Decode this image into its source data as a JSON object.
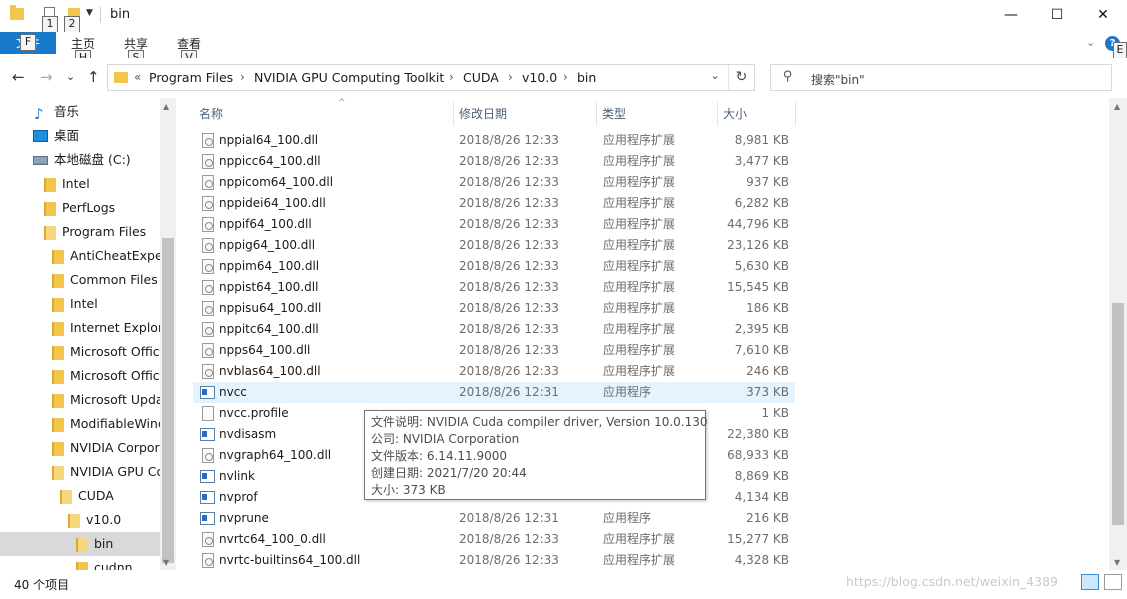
{
  "window": {
    "title": "bin",
    "minimize_glyph": "—",
    "maximize_glyph": "☐",
    "close_glyph": "✕"
  },
  "keytips": {
    "qat1": "1",
    "qat2": "2",
    "file": "F",
    "home": "H",
    "share": "S",
    "view": "V",
    "help": "E"
  },
  "ribbon": {
    "file_label": "文件",
    "tabs": [
      "主页",
      "共享",
      "查看"
    ],
    "help_glyph": "?"
  },
  "nav": {
    "back_glyph": "←",
    "forward_glyph": "→",
    "recent_glyph": "⌄",
    "up_glyph": "↑"
  },
  "address": {
    "overflow": "«",
    "crumbs": [
      "Program Files",
      "NVIDIA GPU Computing Toolkit",
      "CUDA",
      "v10.0",
      "bin"
    ],
    "dropdown_glyph": "⌄",
    "refresh_glyph": "↻"
  },
  "search": {
    "placeholder": "搜索\"bin\"",
    "icon": "search-icon"
  },
  "tree": [
    {
      "label": "音乐",
      "icon": "music-icon"
    },
    {
      "label": "桌面",
      "icon": "desktop-icon"
    },
    {
      "label": "本地磁盘 (C:)",
      "icon": "drive-icon"
    },
    {
      "label": "Intel",
      "icon": "folder-icon"
    },
    {
      "label": "PerfLogs",
      "icon": "folder-icon"
    },
    {
      "label": "Program Files",
      "icon": "folder-icon"
    },
    {
      "label": "AntiCheatExpert",
      "icon": "folder-icon"
    },
    {
      "label": "Common Files",
      "icon": "folder-icon"
    },
    {
      "label": "Intel",
      "icon": "folder-icon"
    },
    {
      "label": "Internet Explorer",
      "icon": "folder-icon"
    },
    {
      "label": "Microsoft Office",
      "icon": "folder-icon"
    },
    {
      "label": "Microsoft Office",
      "icon": "folder-icon"
    },
    {
      "label": "Microsoft Update",
      "icon": "folder-icon"
    },
    {
      "label": "ModifiableWind",
      "icon": "folder-icon"
    },
    {
      "label": "NVIDIA Corpor",
      "icon": "folder-icon"
    },
    {
      "label": "NVIDIA GPU Co",
      "icon": "folder-icon"
    },
    {
      "label": "CUDA",
      "icon": "folder-icon"
    },
    {
      "label": "v10.0",
      "icon": "folder-icon"
    },
    {
      "label": "bin",
      "icon": "folder-icon",
      "selected": true
    },
    {
      "label": "cudnn",
      "icon": "folder-icon"
    }
  ],
  "columns": {
    "name": "名称",
    "date": "修改日期",
    "type": "类型",
    "size": "大小"
  },
  "files": [
    {
      "name": "nppial64_100.dll",
      "date": "2018/8/26 12:33",
      "type": "应用程序扩展",
      "size": "8,981 KB",
      "icon": "dll"
    },
    {
      "name": "nppicc64_100.dll",
      "date": "2018/8/26 12:33",
      "type": "应用程序扩展",
      "size": "3,477 KB",
      "icon": "dll"
    },
    {
      "name": "nppicom64_100.dll",
      "date": "2018/8/26 12:33",
      "type": "应用程序扩展",
      "size": "937 KB",
      "icon": "dll"
    },
    {
      "name": "nppidei64_100.dll",
      "date": "2018/8/26 12:33",
      "type": "应用程序扩展",
      "size": "6,282 KB",
      "icon": "dll"
    },
    {
      "name": "nppif64_100.dll",
      "date": "2018/8/26 12:33",
      "type": "应用程序扩展",
      "size": "44,796 KB",
      "icon": "dll"
    },
    {
      "name": "nppig64_100.dll",
      "date": "2018/8/26 12:33",
      "type": "应用程序扩展",
      "size": "23,126 KB",
      "icon": "dll"
    },
    {
      "name": "nppim64_100.dll",
      "date": "2018/8/26 12:33",
      "type": "应用程序扩展",
      "size": "5,630 KB",
      "icon": "dll"
    },
    {
      "name": "nppist64_100.dll",
      "date": "2018/8/26 12:33",
      "type": "应用程序扩展",
      "size": "15,545 KB",
      "icon": "dll"
    },
    {
      "name": "nppisu64_100.dll",
      "date": "2018/8/26 12:33",
      "type": "应用程序扩展",
      "size": "186 KB",
      "icon": "dll"
    },
    {
      "name": "nppitc64_100.dll",
      "date": "2018/8/26 12:33",
      "type": "应用程序扩展",
      "size": "2,395 KB",
      "icon": "dll"
    },
    {
      "name": "npps64_100.dll",
      "date": "2018/8/26 12:33",
      "type": "应用程序扩展",
      "size": "7,610 KB",
      "icon": "dll"
    },
    {
      "name": "nvblas64_100.dll",
      "date": "2018/8/26 12:33",
      "type": "应用程序扩展",
      "size": "246 KB",
      "icon": "dll"
    },
    {
      "name": "nvcc",
      "date": "2018/8/26 12:31",
      "type": "应用程序",
      "size": "373 KB",
      "icon": "exe",
      "hovered": true
    },
    {
      "name": "nvcc.profile",
      "date": "",
      "type": "",
      "size": "1 KB",
      "icon": "doc"
    },
    {
      "name": "nvdisasm",
      "date": "",
      "type": "",
      "size": "22,380 KB",
      "icon": "exe"
    },
    {
      "name": "nvgraph64_100.dll",
      "date": "",
      "type": "",
      "size": "68,933 KB",
      "icon": "dll"
    },
    {
      "name": "nvlink",
      "date": "",
      "type": "",
      "size": "8,869 KB",
      "icon": "exe"
    },
    {
      "name": "nvprof",
      "date": "",
      "type": "",
      "size": "4,134 KB",
      "icon": "exe"
    },
    {
      "name": "nvprune",
      "date": "2018/8/26 12:31",
      "type": "应用程序",
      "size": "216 KB",
      "icon": "exe"
    },
    {
      "name": "nvrtc64_100_0.dll",
      "date": "2018/8/26 12:33",
      "type": "应用程序扩展",
      "size": "15,277 KB",
      "icon": "dll"
    },
    {
      "name": "nvrtc-builtins64_100.dll",
      "date": "2018/8/26 12:33",
      "type": "应用程序扩展",
      "size": "4,328 KB",
      "icon": "dll"
    }
  ],
  "tooltip": {
    "lines": [
      "文件说明: NVIDIA Cuda compiler driver, Version 10.0.130",
      "公司: NVIDIA Corporation",
      "文件版本: 6.14.11.9000",
      "创建日期: 2021/7/20 20:44",
      "大小: 373 KB"
    ]
  },
  "status": {
    "count": "40 个项目",
    "watermark": "https://blog.csdn.net/weixin_4389"
  },
  "colors": {
    "file_tab": "#1979ca",
    "hover_row": "#e5f3ff",
    "folder": "#f3c54b"
  }
}
